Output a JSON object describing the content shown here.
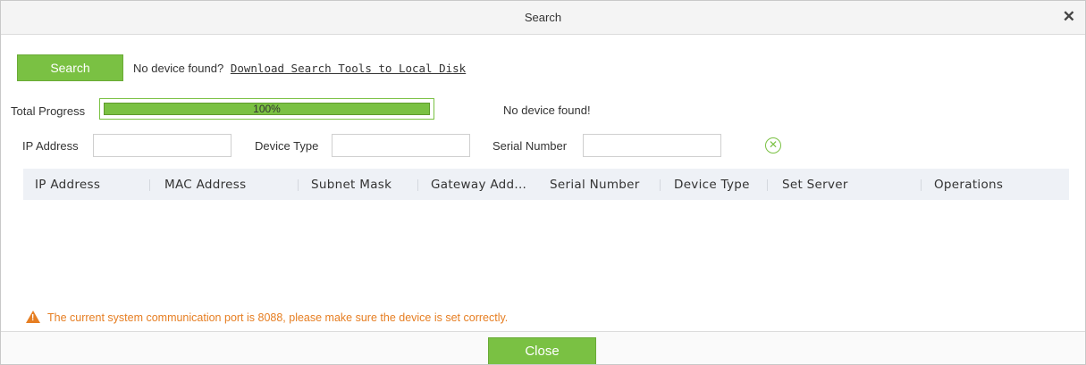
{
  "dialog": {
    "title": "Search",
    "close_icon": "close-icon"
  },
  "toolbar": {
    "search_label": "Search",
    "no_device_prompt": "No device found?",
    "download_link": "Download Search Tools to Local Disk"
  },
  "progress": {
    "label": "Total Progress",
    "value_text": "100%",
    "value_fraction": 1.0,
    "status": "No device found!",
    "color": "#7ac143"
  },
  "filters": {
    "ip_label": "IP Address",
    "ip_value": "",
    "type_label": "Device Type",
    "type_value": "",
    "serial_label": "Serial Number",
    "serial_value": "",
    "clear_icon": "clear-circle-icon"
  },
  "table": {
    "columns": [
      "IP Address",
      "MAC Address",
      "Subnet Mask",
      "Gateway Add...",
      "Serial Number",
      "Device Type",
      "Set Server",
      "Operations"
    ],
    "rows": []
  },
  "warning": {
    "icon": "warning-icon",
    "text": "The current system communication port is 8088, please make sure the device is set correctly.",
    "color": "#e67e22"
  },
  "footer": {
    "close_label": "Close"
  }
}
